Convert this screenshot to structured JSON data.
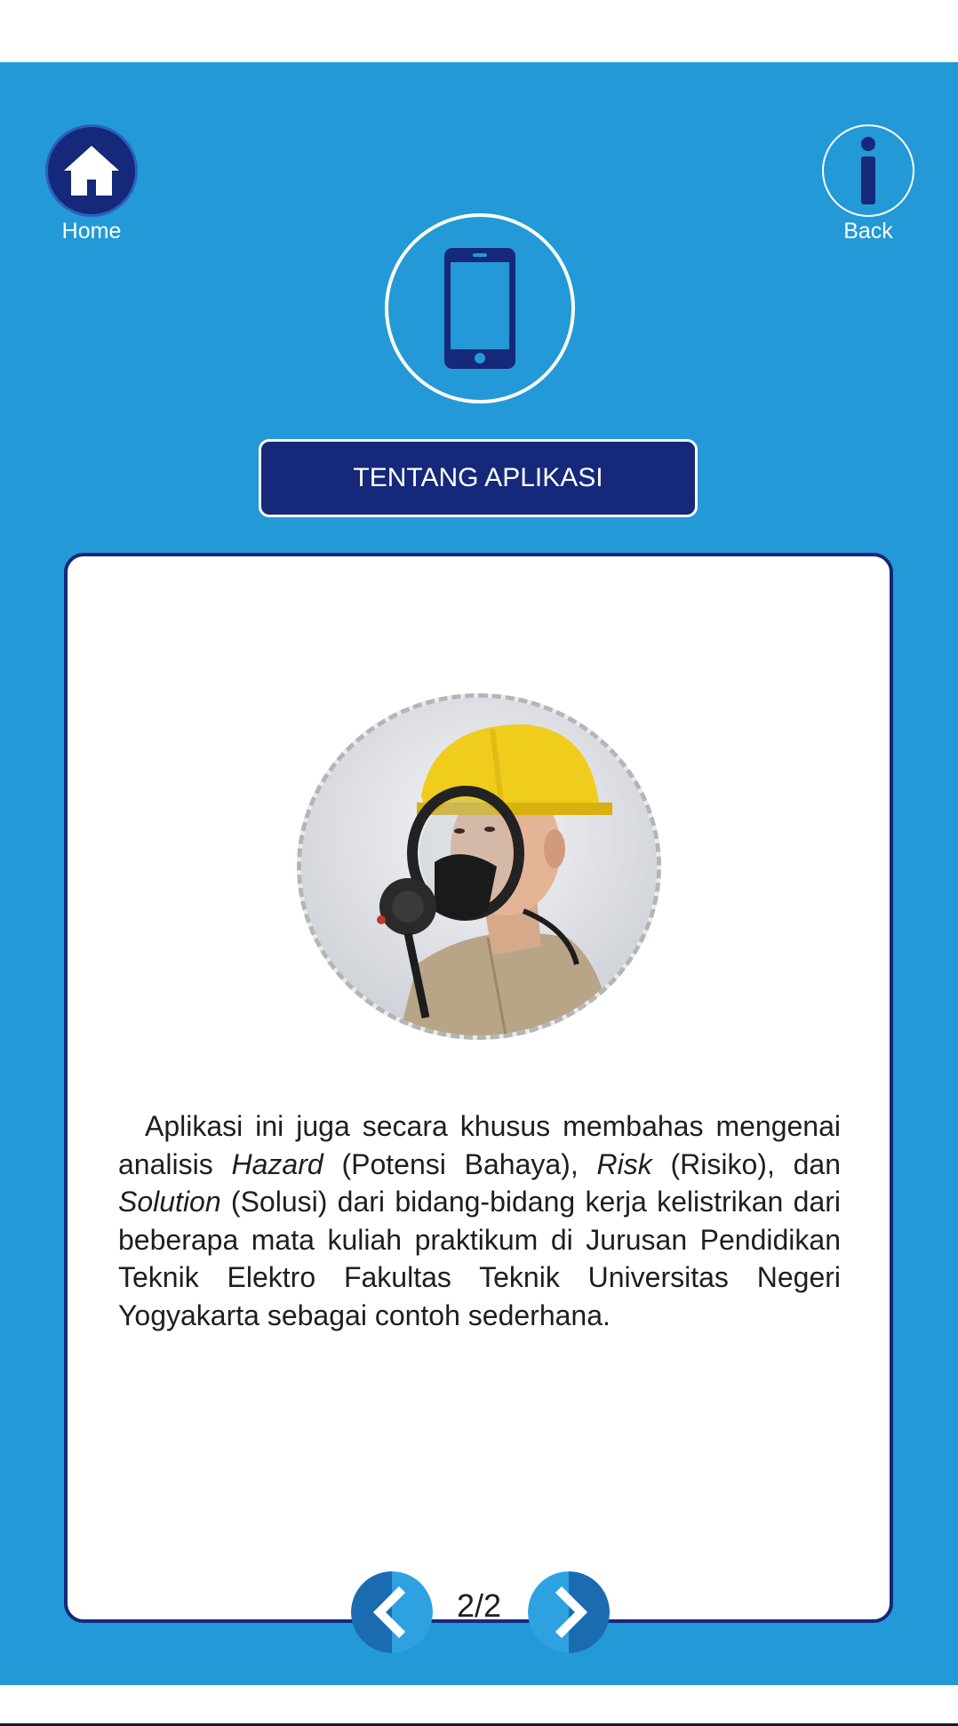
{
  "nav": {
    "home_label": "Home",
    "back_label": "Back",
    "home_icon": "home-icon",
    "back_icon": "info-icon"
  },
  "header": {
    "icon": "smartphone-icon",
    "title": "TENTANG APLIKASI"
  },
  "content": {
    "image": "firefighter-helmet-mask-photo",
    "paragraph": [
      {
        "text": "Aplikasi ini juga secara khusus membahas mengenai analisis ",
        "italic": false
      },
      {
        "text": "Hazard",
        "italic": true
      },
      {
        "text": " (Potensi Bahaya), ",
        "italic": false
      },
      {
        "text": "Risk",
        "italic": true
      },
      {
        "text": " (Risiko), dan ",
        "italic": false
      },
      {
        "text": "Solution",
        "italic": true
      },
      {
        "text": " (Solusi) dari bidang-bidang kerja kelistrikan dari beberapa mata kuliah praktikum di Jurusan Pendidikan Teknik Elektro Fakultas Teknik Universitas Negeri Yogyakarta sebagai contoh sederhana.",
        "italic": false
      }
    ]
  },
  "pager": {
    "indicator": "2/2",
    "prev_icon": "chevron-left-icon",
    "next_icon": "chevron-right-icon"
  },
  "colors": {
    "background": "#2399d7",
    "primary_dark": "#15287a",
    "card": "#ffffff",
    "pager_dark": "#1b6bb0",
    "pager_light": "#2ea2e0"
  }
}
